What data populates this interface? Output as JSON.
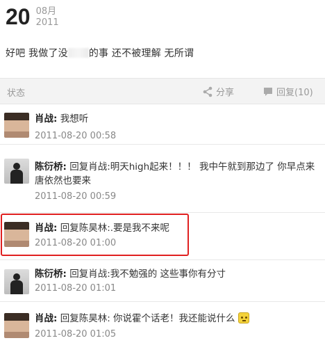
{
  "post": {
    "day": "20",
    "month": "08月",
    "year": "2011",
    "text_before": "好吧 我做了没",
    "text_after": "的事 还不被理解 无所谓"
  },
  "actions": {
    "status_label": "状态",
    "share_label": "分享",
    "reply_label": "回复(10)"
  },
  "comments": [
    {
      "author": "肖战:",
      "text": " 我想听",
      "time": "2011-08-20 00:58"
    },
    {
      "author": "陈衍桥:",
      "text": " 回复肖战:明天high起来！！！ 我中午就到那边了 你早点来 唐依然也要来",
      "time": "2011-08-20 00:59"
    },
    {
      "author": "肖战:",
      "text": " 回复陈昊林:.要是我不来呢",
      "time": "2011-08-20 01:00"
    },
    {
      "author": "陈衍桥:",
      "text": " 回复肖战:我不勉强的 这些事你有分寸",
      "time": "2011-08-20 01:01"
    },
    {
      "author": "肖战:",
      "text": " 回复陈昊林: 你说霍个话老！我还能说什么",
      "time": "2011-08-20 01:05"
    }
  ],
  "icons": {
    "share": "share-icon",
    "reply": "comment-icon",
    "emoji": "emoji-icon"
  }
}
